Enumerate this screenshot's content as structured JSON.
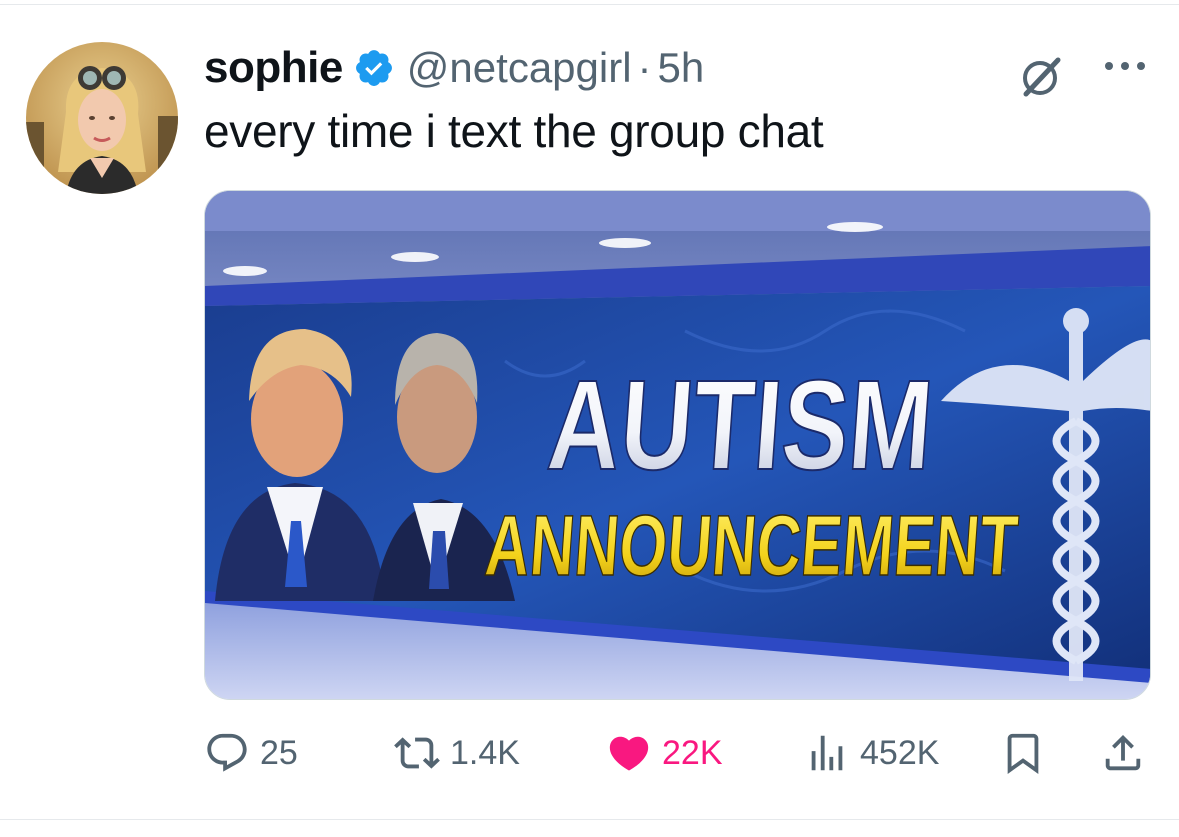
{
  "tweet": {
    "display_name": "sophie",
    "handle": "@netcapgirl",
    "separator": "·",
    "time": "5h",
    "text": "every time i text the group chat"
  },
  "media": {
    "headline_top": "AUTISM",
    "headline_bottom": "ANNOUNCEMENT"
  },
  "actions": {
    "replies": "25",
    "reposts": "1.4K",
    "likes": "22K",
    "views": "452K"
  },
  "icons": {
    "verified": "verified-badge-icon",
    "grok": "grok-icon",
    "more": "more-icon",
    "reply": "reply-icon",
    "repost": "repost-icon",
    "like": "heart-icon",
    "views": "views-icon",
    "bookmark": "bookmark-icon",
    "share": "share-icon"
  },
  "colors": {
    "verified": "#1d9bf0",
    "like": "#f91880",
    "secondary_text": "#536471",
    "headline_white": "#f4f6fb",
    "headline_yellow": "#f3d21b"
  }
}
